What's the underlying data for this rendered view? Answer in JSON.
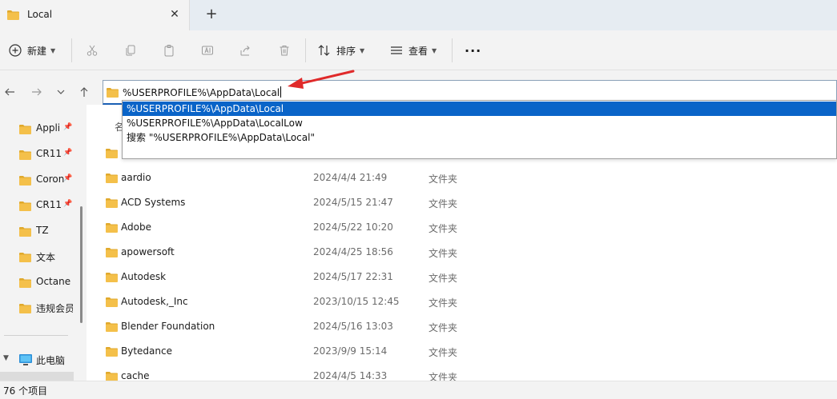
{
  "window": {
    "tab_title": "Local",
    "tab_close_glyph": "✕",
    "new_tab_glyph": "+"
  },
  "toolbar": {
    "new_label": "新建",
    "sort_label": "排序",
    "view_label": "查看",
    "more_glyph": "···"
  },
  "address": {
    "value": "%USERPROFILE%\\AppData\\Local"
  },
  "suggestions": [
    "%USERPROFILE%\\AppData\\Local",
    "%USERPROFILE%\\AppData\\LocalLow",
    "搜索 \"%USERPROFILE%\\AppData\\Local\""
  ],
  "nav": {
    "items": [
      {
        "label": "Appli",
        "pinned": true
      },
      {
        "label": "CR11",
        "pinned": true
      },
      {
        "label": "Coron",
        "pinned": true
      },
      {
        "label": "CR11",
        "pinned": true
      },
      {
        "label": "TZ",
        "pinned": false
      },
      {
        "label": "文本",
        "pinned": false
      },
      {
        "label": "Octane I",
        "pinned": false
      },
      {
        "label": "违规会员",
        "pinned": false
      }
    ],
    "this_pc": "此电脑"
  },
  "list": {
    "name_header": "名",
    "rows": [
      {
        "name": "aardio",
        "date": "2024/4/4 21:49",
        "type": "文件夹"
      },
      {
        "name": "ACD Systems",
        "date": "2024/5/15 21:47",
        "type": "文件夹"
      },
      {
        "name": "Adobe",
        "date": "2024/5/22 10:20",
        "type": "文件夹"
      },
      {
        "name": "apowersoft",
        "date": "2024/4/25 18:56",
        "type": "文件夹"
      },
      {
        "name": "Autodesk",
        "date": "2024/5/17 22:31",
        "type": "文件夹"
      },
      {
        "name": "Autodesk,_Inc",
        "date": "2023/10/15 12:45",
        "type": "文件夹"
      },
      {
        "name": "Blender Foundation",
        "date": "2024/5/16 13:03",
        "type": "文件夹"
      },
      {
        "name": "Bytedance",
        "date": "2023/9/9 15:14",
        "type": "文件夹"
      },
      {
        "name": "cache",
        "date": "2024/4/5 14:33",
        "type": "文件夹"
      }
    ]
  },
  "status": {
    "item_count": "76 个项目"
  },
  "colors": {
    "folder": "#f4c04a",
    "folder_dark": "#e0a92c",
    "accent": "#0a64c8",
    "annotation_arrow": "#e02a2a"
  },
  "icons": [
    "folder-icon",
    "close-icon",
    "plus-icon",
    "new-icon",
    "cut-icon",
    "copy-icon",
    "paste-icon",
    "rename-icon",
    "share-icon",
    "delete-icon",
    "sort-icon",
    "view-icon",
    "more-icon",
    "back-icon",
    "forward-icon",
    "recent-icon",
    "up-icon",
    "pin-icon",
    "computer-icon"
  ]
}
